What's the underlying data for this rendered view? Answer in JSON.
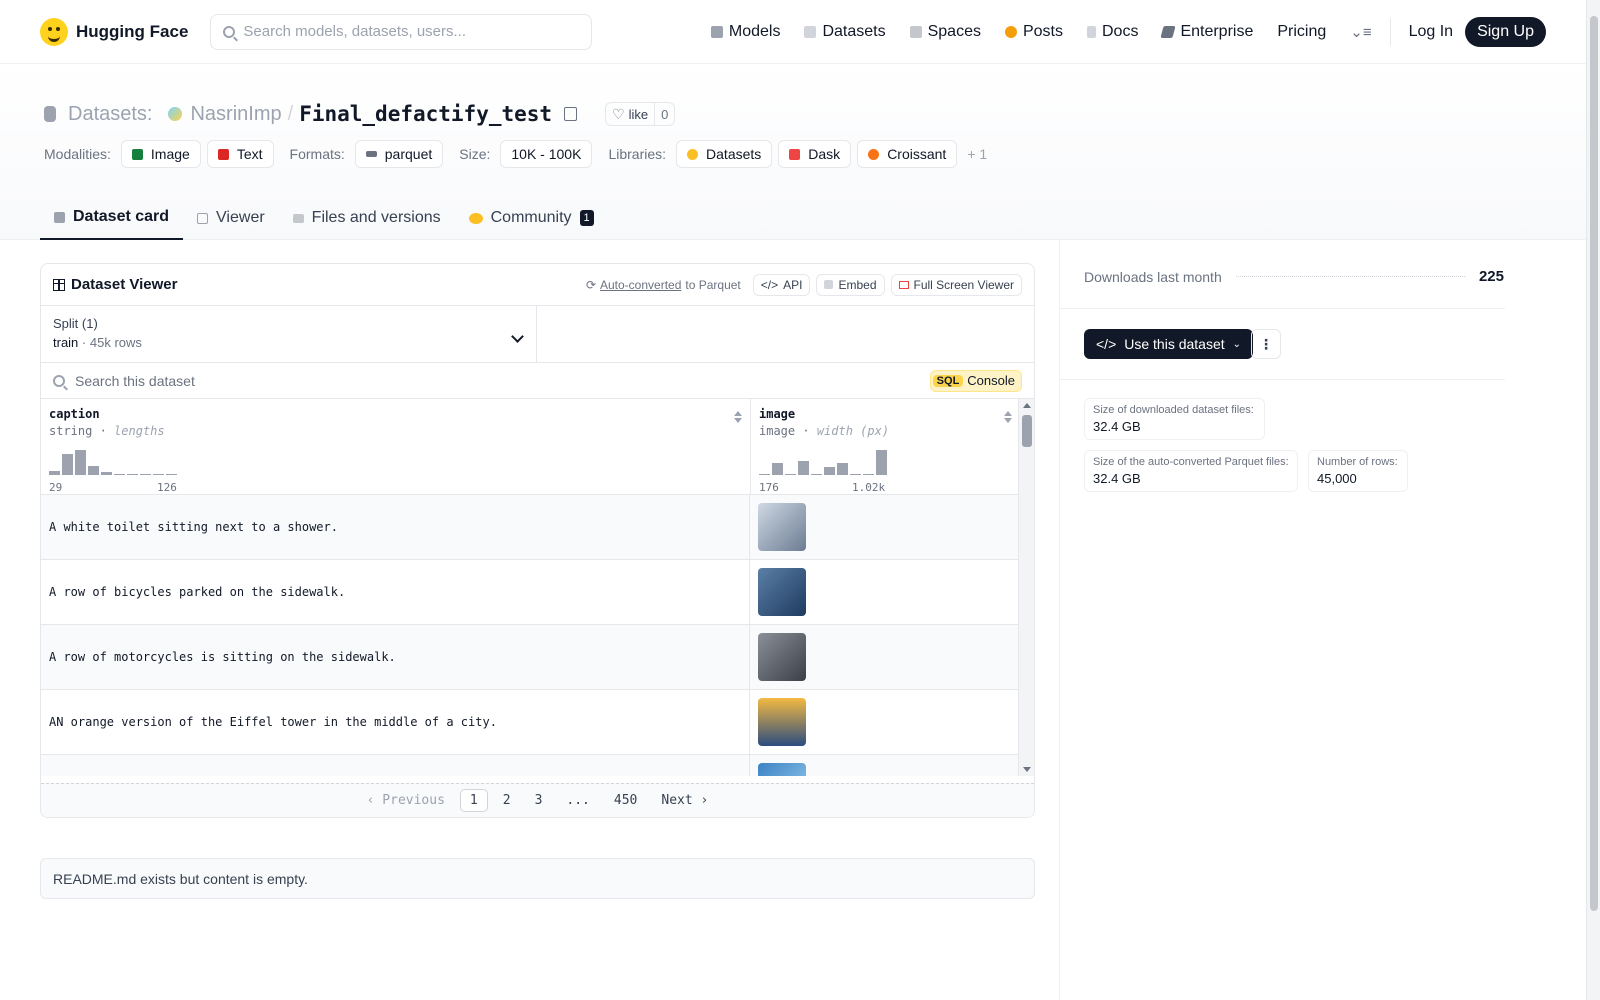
{
  "nav": {
    "brand": "Hugging Face",
    "search_placeholder": "Search models, datasets, users...",
    "links": [
      {
        "label": "Models",
        "icon": "models-icon",
        "color": "#9ca3af"
      },
      {
        "label": "Datasets",
        "icon": "datasets-icon",
        "color": "#9ca3af"
      },
      {
        "label": "Spaces",
        "icon": "spaces-icon",
        "color": "#9ca3af"
      },
      {
        "label": "Posts",
        "icon": "posts-icon",
        "color": "#f59e0b"
      },
      {
        "label": "Docs",
        "icon": "docs-icon",
        "color": "#9ca3af"
      },
      {
        "label": "Enterprise",
        "icon": "enterprise-icon",
        "color": "#6b7280"
      },
      {
        "label": "Pricing",
        "icon": "",
        "color": ""
      }
    ],
    "login": "Log In",
    "signup": "Sign Up"
  },
  "header": {
    "section": "Datasets:",
    "owner": "NasrinImp",
    "slash": "/",
    "name": "Final_defactify_test",
    "like_label": "like",
    "like_count": "0",
    "modalities_label": "Modalities:",
    "modalities": [
      "Image",
      "Text"
    ],
    "formats_label": "Formats:",
    "format": "parquet",
    "size_label": "Size:",
    "size": "10K - 100K",
    "libraries_label": "Libraries:",
    "libraries": [
      "Datasets",
      "Dask",
      "Croissant"
    ],
    "more": "+ 1"
  },
  "tabs": [
    {
      "label": "Dataset card",
      "active": true
    },
    {
      "label": "Viewer",
      "active": false
    },
    {
      "label": "Files and versions",
      "active": false
    },
    {
      "label": "Community",
      "active": false,
      "badge": "1"
    }
  ],
  "viewer": {
    "title": "Dataset Viewer",
    "auto_link": "Auto-converted",
    "auto_rest": " to Parquet",
    "api": "API",
    "embed": "Embed",
    "fullscreen": "Full Screen Viewer",
    "split_label": "Split (1)",
    "split_name": "train",
    "split_dot": "·",
    "split_rows": "45k rows",
    "search_placeholder": "Search this dataset",
    "sql_tag": "SQL",
    "sql_label": "Console",
    "columns": [
      {
        "name": "caption",
        "type": "string",
        "stat": "lengths",
        "min": "29",
        "max": "126",
        "hist": [
          0.15,
          0.8,
          0.95,
          0.35,
          0.12,
          0.05,
          0.04,
          0.03,
          0.03,
          0.03
        ]
      },
      {
        "name": "image",
        "type": "image",
        "stat": "width (px)",
        "min": "176",
        "max": "1.02k",
        "hist": [
          0.05,
          0.45,
          0.05,
          0.55,
          0.05,
          0.3,
          0.45,
          0.0,
          0.0,
          0.95
        ]
      }
    ],
    "rows": [
      {
        "caption": "A white toilet sitting next to a shower.",
        "thumb": "linear-gradient(135deg,#cfd8e3,#6b7c93)"
      },
      {
        "caption": "A row of bicycles parked on the sidewalk.",
        "thumb": "linear-gradient(135deg,#5b7fa6,#1e3a5f)"
      },
      {
        "caption": "A row of motorcycles is sitting on the sidewalk.",
        "thumb": "linear-gradient(135deg,#8a8f98,#3a3f48)"
      },
      {
        "caption": "AN orange version of the Eiffel tower in the middle of a city.",
        "thumb": "linear-gradient(180deg,#f4b942,#2b4c7e)"
      },
      {
        "caption": "",
        "thumb": "linear-gradient(135deg,#3b82c4,#9ed0f0)"
      }
    ],
    "pager": {
      "prev": "Previous",
      "pages": [
        "1",
        "2",
        "3",
        "...",
        "450"
      ],
      "next": "Next"
    }
  },
  "readme": "README.md exists but content is empty.",
  "sidebar": {
    "downloads_label": "Downloads last month",
    "downloads_value": "225",
    "use_button": "Use this dataset",
    "stats": [
      {
        "label": "Size of downloaded dataset files:",
        "value": "32.4 GB"
      },
      {
        "label": "Size of the auto-converted Parquet files:",
        "value": "32.4 GB"
      },
      {
        "label": "Number of rows:",
        "value": "45,000"
      }
    ]
  }
}
